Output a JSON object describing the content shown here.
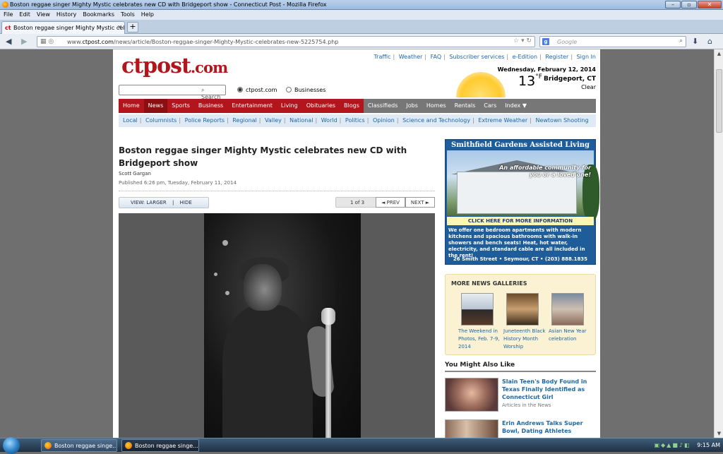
{
  "window": {
    "title": "Boston reggae singer Mighty Mystic celebrates new CD with Bridgeport show - Connecticut Post - Mozilla Firefox"
  },
  "menu": [
    "File",
    "Edit",
    "View",
    "History",
    "Bookmarks",
    "Tools",
    "Help"
  ],
  "tabs": [
    {
      "label": "Boston reggae singer Mighty Mystic cele...",
      "favicon": "ct"
    }
  ],
  "new_tab": "+",
  "url": {
    "prefix": "www.",
    "domain": "ctpost.com",
    "path": "/news/article/Boston-reggae-singer-Mighty-Mystic-celebrates-new-5225754.php"
  },
  "search": {
    "engine": "g",
    "placeholder": "Google"
  },
  "site": {
    "logo": "ctpost",
    "logo_suffix": ".com",
    "top_links": [
      "Traffic",
      "Weather",
      "FAQ",
      "Subscriber services",
      "e-Edition",
      "Register",
      "Sign In"
    ],
    "date": "Wednesday, February 12, 2014",
    "temp": "13",
    "temp_unit": "°F",
    "city": "Bridgeport, CT",
    "condition": "Clear",
    "search_label": "Search",
    "radio_options": [
      "ctpost.com",
      "Businesses"
    ],
    "radio_selected": "ctpost.com"
  },
  "main_nav": [
    "Home",
    "News",
    "Sports",
    "Business",
    "Entertainment",
    "Living",
    "Obituaries",
    "Blogs"
  ],
  "main_nav_active": "News",
  "main_nav_gray": [
    "Classifieds",
    "Jobs",
    "Homes",
    "Rentals",
    "Cars",
    "Index ▼"
  ],
  "sub_nav": [
    "Local",
    "Columnists",
    "Police Reports",
    "Regional",
    "Valley",
    "National",
    "World",
    "Politics",
    "Opinion",
    "Science and Technology",
    "Extreme Weather",
    "Newtown Shooting"
  ],
  "article": {
    "headline": "Boston reggae singer Mighty Mystic celebrates new CD with Bridgeport show",
    "byline": "Scott Gargan",
    "published": "Published 6:26 pm, Tuesday, February 11, 2014",
    "view_larger": "VIEW: LARGER",
    "hide": "HIDE",
    "pager": "1 of 3",
    "prev": "◄ PREV",
    "next": "NEXT ►"
  },
  "ad": {
    "title": "Smithfield Gardens Assisted Living",
    "tagline": "An affordable community for you or a loved one!",
    "cta": "CLICK HERE FOR MORE INFORMATION",
    "body": "We offer one bedroom apartments with modern kitchens and spacious bathrooms with walk-in showers and bench seats! Heat, hot water, electricity, and standard cable are all included in the rent!",
    "address": "26 Smith Street • Seymour, CT • (203) 888.1835"
  },
  "galleries": {
    "title": "MORE NEWS GALLERIES",
    "items": [
      {
        "caption": "The Weekend in Photos, Feb. 7-9, 2014"
      },
      {
        "caption": "Juneteenth Black History Month Worship"
      },
      {
        "caption": "Asian New Year celebration"
      }
    ]
  },
  "also_like": {
    "title": "You Might Also Like",
    "stories": [
      {
        "title": "Slain Teen's Body Found in Texas Finally Identified as Connecticut Girl",
        "source": "Articles in the News"
      },
      {
        "title": "Erin Andrews Talks Super Bowl, Dating Athletes",
        "source": ""
      }
    ]
  },
  "taskbar": {
    "tasks": [
      "Boston reggae singe...",
      "Boston reggae singe..."
    ],
    "clock": "9:15 AM"
  },
  "colors": {
    "brand_red": "#b3151c",
    "link_blue": "#1c67a6",
    "ad_blue": "#1e5d9a"
  }
}
